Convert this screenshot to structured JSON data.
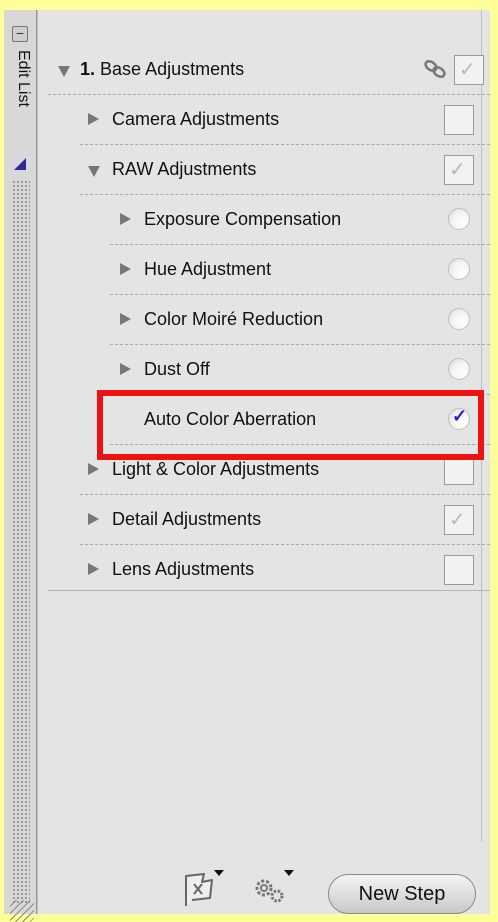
{
  "side_tab": {
    "label": "Edit List"
  },
  "step": {
    "number": "1.",
    "title": "Base Adjustments"
  },
  "rows": [
    {
      "label": "Camera Adjustments"
    },
    {
      "label": "RAW Adjustments"
    },
    {
      "label": "Exposure Compensation"
    },
    {
      "label": "Hue Adjustment"
    },
    {
      "label": "Color Moiré Reduction"
    },
    {
      "label": "Dust Off"
    },
    {
      "label": "Auto Color Aberration"
    },
    {
      "label": "Light & Color Adjustments"
    },
    {
      "label": "Detail Adjustments"
    },
    {
      "label": "Lens Adjustments"
    }
  ],
  "toolbar": {
    "new_step_label": "New Step"
  },
  "colors": {
    "background": "#ffff99",
    "highlight": "#ee1111",
    "check": "#2222cc"
  }
}
